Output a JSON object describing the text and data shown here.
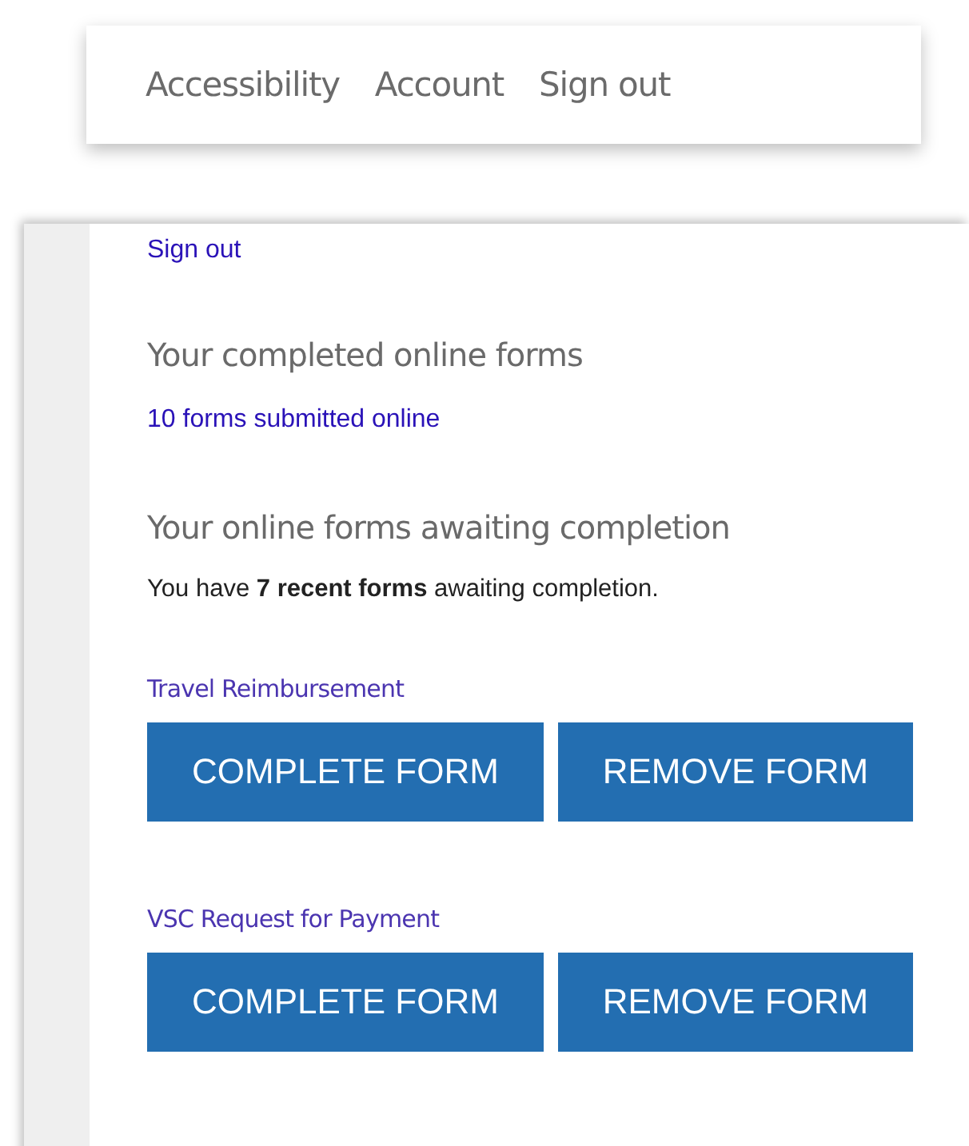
{
  "top_nav": {
    "links": [
      "Accessibility",
      "Account",
      "Sign out"
    ]
  },
  "panel": {
    "sign_out_link": "Sign out",
    "completed": {
      "heading": "Your completed online forms",
      "link": "10 forms submitted online"
    },
    "awaiting": {
      "heading": "Your online forms awaiting completion",
      "summary": "You have **7 recent forms** awaiting completion.",
      "forms": [
        {
          "title": "Travel Reimbursement",
          "buttons": [
            "COMPLETE FORM",
            "REMOVE FORM"
          ]
        },
        {
          "title": "VSC Request for Payment",
          "buttons": [
            "COMPLETE FORM",
            "REMOVE FORM"
          ]
        }
      ]
    }
  }
}
